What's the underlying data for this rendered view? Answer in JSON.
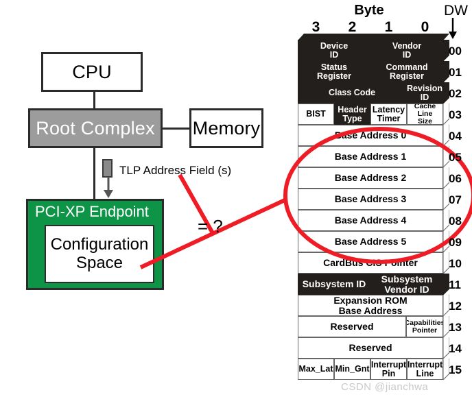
{
  "diagram": {
    "blocks": {
      "cpu": "CPU",
      "root_complex": "Root Complex",
      "memory": "Memory",
      "endpoint_title": "PCI-XP Endpoint",
      "config_space_line1": "Configuration",
      "config_space_line2": "Space"
    },
    "tlp_label": "TLP Address Field (s)",
    "equals_label": "= ?",
    "colors": {
      "endpoint_fill": "#0d9447",
      "root_complex_fill": "#9c9c9c",
      "annotation_red": "#ee1c25",
      "cell_black": "#231f1c",
      "tlp_marker": "#8a8a8a"
    }
  },
  "register_table": {
    "byte_header": "Byte",
    "byte_numbers": [
      "3",
      "2",
      "1",
      "0"
    ],
    "dw_header": "DW",
    "rows": [
      {
        "dw": "00",
        "cells": [
          {
            "label": "Device\nID",
            "span": 2,
            "style": "black"
          },
          {
            "label": "Vendor\nID",
            "span": 2,
            "style": "black"
          }
        ]
      },
      {
        "dw": "01",
        "cells": [
          {
            "label": "Status\nRegister",
            "span": 2,
            "style": "black"
          },
          {
            "label": "Command\nRegister",
            "span": 2,
            "style": "black"
          }
        ]
      },
      {
        "dw": "02",
        "cells": [
          {
            "label": "Class Code",
            "span": 3,
            "style": "black"
          },
          {
            "label": "Revision\nID",
            "span": 1,
            "style": "black"
          }
        ]
      },
      {
        "dw": "03",
        "cells": [
          {
            "label": "BIST",
            "span": 1,
            "style": "white"
          },
          {
            "label": "Header\nType",
            "span": 1,
            "style": "black"
          },
          {
            "label": "Latency\nTimer",
            "span": 1,
            "style": "white"
          },
          {
            "label": "Cache\nLine\nSize",
            "span": 1,
            "style": "white",
            "size": "sm"
          }
        ]
      },
      {
        "dw": "04",
        "cells": [
          {
            "label": "Base Address 0",
            "span": 4,
            "style": "white",
            "size": "big"
          }
        ]
      },
      {
        "dw": "05",
        "cells": [
          {
            "label": "Base Address 1",
            "span": 4,
            "style": "white",
            "size": "big"
          }
        ]
      },
      {
        "dw": "06",
        "cells": [
          {
            "label": "Base Address 2",
            "span": 4,
            "style": "white",
            "size": "big"
          }
        ]
      },
      {
        "dw": "07",
        "cells": [
          {
            "label": "Base Address 3",
            "span": 4,
            "style": "white",
            "size": "big"
          }
        ]
      },
      {
        "dw": "08",
        "cells": [
          {
            "label": "Base Address 4",
            "span": 4,
            "style": "white",
            "size": "big"
          }
        ]
      },
      {
        "dw": "09",
        "cells": [
          {
            "label": "Base Address 5",
            "span": 4,
            "style": "white",
            "size": "big"
          }
        ]
      },
      {
        "dw": "10",
        "cells": [
          {
            "label": "CardBus CIS Pointer",
            "span": 4,
            "style": "white",
            "size": "big"
          }
        ]
      },
      {
        "dw": "11",
        "cells": [
          {
            "label": "Subsystem ID",
            "span": 2,
            "style": "black",
            "size": "big"
          },
          {
            "label": "Subsystem\nVendor ID",
            "span": 2,
            "style": "black",
            "size": "big"
          }
        ]
      },
      {
        "dw": "12",
        "cells": [
          {
            "label": "Expansion ROM\nBase Address",
            "span": 4,
            "style": "white",
            "size": "big"
          }
        ]
      },
      {
        "dw": "13",
        "cells": [
          {
            "label": "Reserved",
            "span": 3,
            "style": "white",
            "size": "big"
          },
          {
            "label": "Capabilities\nPointer",
            "span": 1,
            "style": "white",
            "size": "sm"
          }
        ]
      },
      {
        "dw": "14",
        "cells": [
          {
            "label": "Reserved",
            "span": 4,
            "style": "white",
            "size": "big"
          }
        ]
      },
      {
        "dw": "15",
        "cells": [
          {
            "label": "Max_Lat",
            "span": 1,
            "style": "white"
          },
          {
            "label": "Min_Gnt",
            "span": 1,
            "style": "white"
          },
          {
            "label": "Interrupt\nPin",
            "span": 1,
            "style": "white"
          },
          {
            "label": "Interrupt\nLine",
            "span": 1,
            "style": "white"
          }
        ]
      }
    ]
  },
  "watermark": "CSDN @jianchwa"
}
